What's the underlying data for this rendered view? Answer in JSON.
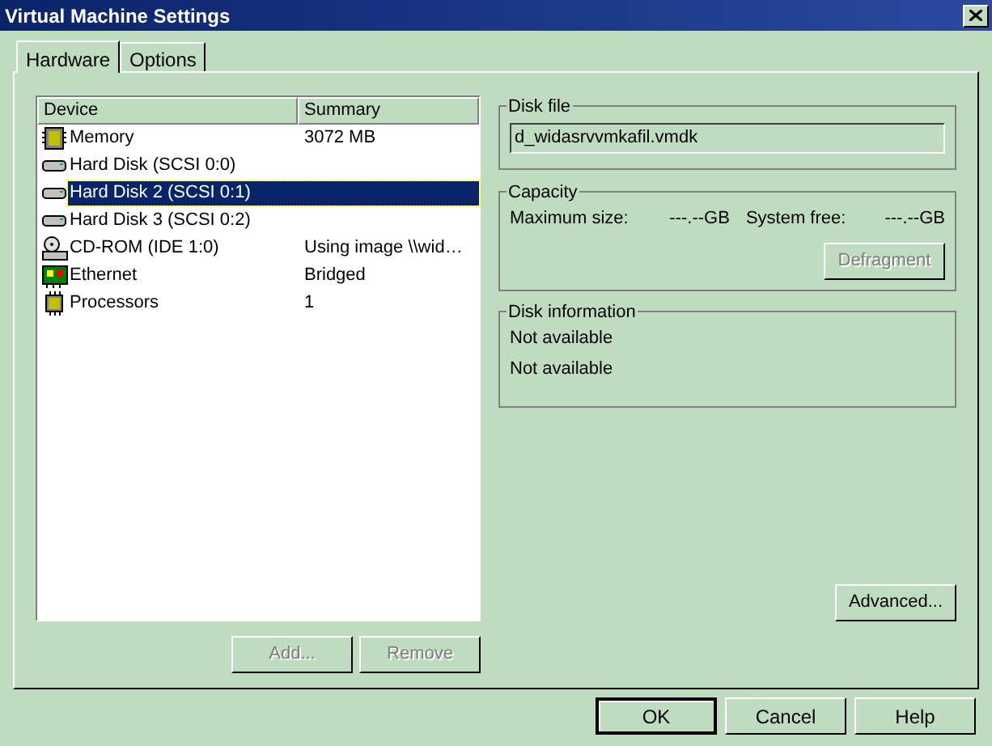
{
  "window": {
    "title": "Virtual Machine Settings"
  },
  "tabs": [
    {
      "label": "Hardware",
      "selected": true
    },
    {
      "label": "Options",
      "selected": false
    }
  ],
  "device_list": {
    "columns": [
      "Device",
      "Summary"
    ],
    "rows": [
      {
        "kind": "memory",
        "device": "Memory",
        "summary": "3072 MB",
        "selected": false
      },
      {
        "kind": "disk",
        "device": "Hard Disk (SCSI 0:0)",
        "summary": "",
        "selected": false
      },
      {
        "kind": "disk",
        "device": "Hard Disk 2 (SCSI 0:1)",
        "summary": "",
        "selected": true
      },
      {
        "kind": "disk",
        "device": "Hard Disk 3 (SCSI 0:2)",
        "summary": "",
        "selected": false
      },
      {
        "kind": "cdrom",
        "device": "CD-ROM (IDE 1:0)",
        "summary": "Using image \\\\wid…",
        "selected": false
      },
      {
        "kind": "ethernet",
        "device": "Ethernet",
        "summary": "Bridged",
        "selected": false
      },
      {
        "kind": "processor",
        "device": "Processors",
        "summary": "1",
        "selected": false
      }
    ]
  },
  "list_buttons": [
    {
      "label": "Add...",
      "disabled": true
    },
    {
      "label": "Remove",
      "disabled": true
    }
  ],
  "disk_file": {
    "title": "Disk file",
    "value": "d_widasrvvmkafil.vmdk"
  },
  "capacity": {
    "title": "Capacity",
    "max_label": "Maximum size:",
    "max_value": "---.--GB",
    "free_label": "System free:",
    "free_value": "---.--GB",
    "button": {
      "label": "Defragment",
      "disabled": true
    }
  },
  "disk_information": {
    "title": "Disk information",
    "lines": [
      "Not available",
      "Not available"
    ]
  },
  "advanced_button": {
    "label": "Advanced...",
    "disabled": false
  },
  "dialog_buttons": [
    {
      "label": "OK",
      "default": true
    },
    {
      "label": "Cancel",
      "default": false
    },
    {
      "label": "Help",
      "default": false
    }
  ]
}
